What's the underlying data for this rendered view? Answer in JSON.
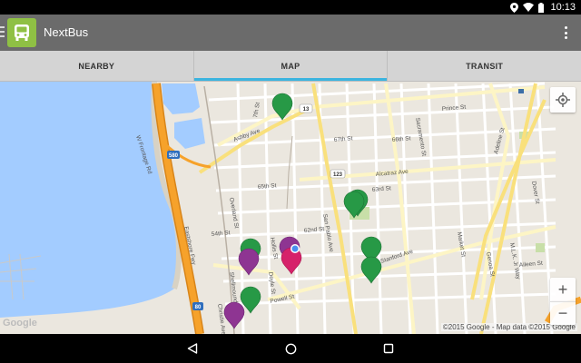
{
  "status_bar": {
    "time": "10:13"
  },
  "app": {
    "title": "NextBus"
  },
  "tabs": [
    {
      "label": "NEARBY",
      "active": false
    },
    {
      "label": "MAP",
      "active": true
    },
    {
      "label": "TRANSIT",
      "active": false
    }
  ],
  "map": {
    "street_labels": [
      "7th St",
      "Ashby Ave",
      "67th St",
      "66th St",
      "65th St",
      "63rd St",
      "62nd St",
      "Alcatraz Ave",
      "Stanford Ave",
      "Powell St",
      "San Pablo Ave",
      "Hollis St",
      "Shellmound St",
      "Doyle St",
      "Overland St",
      "54th St",
      "Prince St",
      "Sacramento St",
      "Adeline St",
      "Dover St",
      "Market St",
      "Genoa St",
      "M.L.K. Jr Way",
      "Aileen St",
      "W Frontage Rd",
      "Christie Ave",
      "Eastshore Fwy"
    ],
    "route_shields": [
      "13",
      "123",
      "580",
      "80"
    ],
    "markers": [
      {
        "color": "green"
      },
      {
        "color": "green"
      },
      {
        "color": "green"
      },
      {
        "color": "green"
      },
      {
        "color": "green"
      },
      {
        "color": "green"
      },
      {
        "color": "purple"
      },
      {
        "color": "purple"
      },
      {
        "color": "purple"
      },
      {
        "color": "magenta"
      }
    ],
    "logo": "Google",
    "attribution": "©2015 Google - Map data ©2015 Google",
    "zoom_in": "+",
    "zoom_out": "−"
  },
  "colors": {
    "accent": "#3bb4df",
    "app_bar": "#6b6b6b",
    "brand_green": "#8fc044",
    "marker_green": "#279946",
    "marker_purple": "#8e3592",
    "marker_magenta": "#d6226a"
  },
  "icons": {
    "status": [
      "location-icon",
      "wifi-icon",
      "battery-icon"
    ],
    "navigation": [
      "back-icon",
      "home-icon",
      "recents-icon"
    ]
  }
}
